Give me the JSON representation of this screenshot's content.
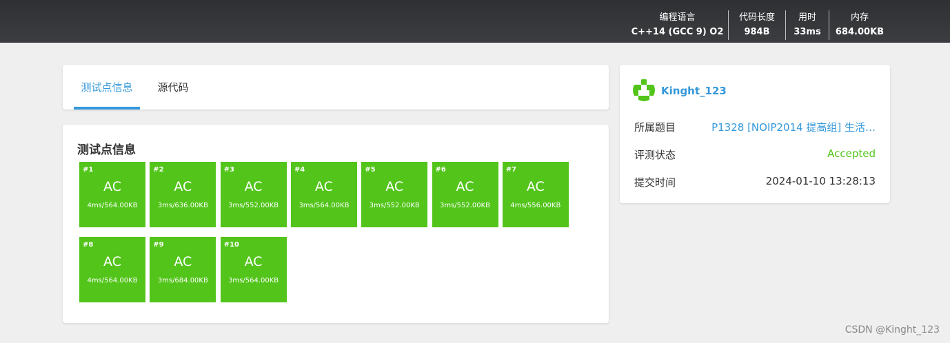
{
  "topbar": {
    "language": {
      "label": "编程语言",
      "value": "C++14 (GCC 9) O2"
    },
    "code_length": {
      "label": "代码长度",
      "value": "984B"
    },
    "time": {
      "label": "用时",
      "value": "33ms"
    },
    "memory": {
      "label": "内存",
      "value": "684.00KB"
    }
  },
  "tabs": [
    {
      "label": "测试点信息",
      "active": true
    },
    {
      "label": "源代码",
      "active": false
    }
  ],
  "cases_section": {
    "title": "测试点信息",
    "cases": [
      {
        "num": "#1",
        "result": "AC",
        "stats": "4ms/564.00KB"
      },
      {
        "num": "#2",
        "result": "AC",
        "stats": "3ms/636.00KB"
      },
      {
        "num": "#3",
        "result": "AC",
        "stats": "3ms/552.00KB"
      },
      {
        "num": "#4",
        "result": "AC",
        "stats": "3ms/564.00KB"
      },
      {
        "num": "#5",
        "result": "AC",
        "stats": "3ms/552.00KB"
      },
      {
        "num": "#6",
        "result": "AC",
        "stats": "3ms/552.00KB"
      },
      {
        "num": "#7",
        "result": "AC",
        "stats": "4ms/556.00KB"
      },
      {
        "num": "#8",
        "result": "AC",
        "stats": "4ms/564.00KB"
      },
      {
        "num": "#9",
        "result": "AC",
        "stats": "3ms/684.00KB"
      },
      {
        "num": "#10",
        "result": "AC",
        "stats": "3ms/564.00KB"
      }
    ],
    "ac_color": "#52c41a"
  },
  "info": {
    "user": "Kinght_123",
    "avatar_icon": "avatar-identicon",
    "problem_label": "所属题目",
    "problem_value": "P1328 [NOIP2014 提高组] 生活…",
    "status_label": "评测状态",
    "status_value": "Accepted",
    "submit_label": "提交时间",
    "submit_value": "2024-01-10 13:28:13"
  },
  "watermark": "CSDN @Kinght_123",
  "colors": {
    "accent": "#3498db",
    "success": "#52c41a",
    "topbar": "#333333"
  }
}
